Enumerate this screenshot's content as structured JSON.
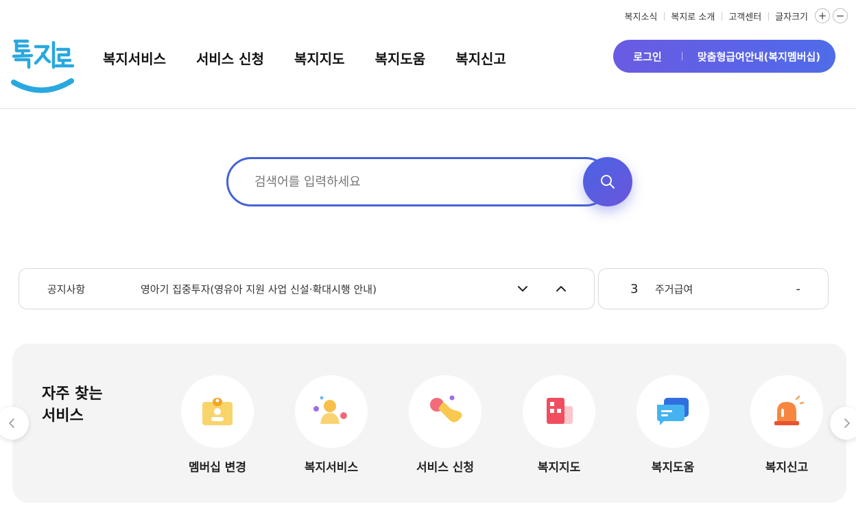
{
  "util": {
    "links": [
      "복지소식",
      "복지로 소개",
      "고객센터"
    ],
    "font_size_label": "글자크기",
    "plus": "+",
    "minus": "−"
  },
  "logo": {
    "text": "복지로",
    "brand_color": "#29a8e0"
  },
  "gnb": [
    "복지서비스",
    "서비스 신청",
    "복지지도",
    "복지도움",
    "복지신고"
  ],
  "member": {
    "login": "로그인",
    "guide": "맞춤형급여안내(복지멤버십)"
  },
  "search": {
    "placeholder": "검색어를 입력하세요",
    "icon": "search-icon"
  },
  "notice": {
    "label": "공지사항",
    "text": "영아기 집중투자(영유아 지원 사업 신설·확대시행 안내)",
    "down_icon": "chevron-down-icon",
    "up_icon": "chevron-up-icon"
  },
  "rank": {
    "number": "3",
    "text": "주거급여",
    "change": "-"
  },
  "frequent": {
    "title": "자주 찾는\n서비스",
    "items": [
      {
        "label": "멤버십 변경",
        "icon": "id-card-icon"
      },
      {
        "label": "복지서비스",
        "icon": "person-icon"
      },
      {
        "label": "서비스 신청",
        "icon": "hand-click-icon"
      },
      {
        "label": "복지지도",
        "icon": "map-icon"
      },
      {
        "label": "복지도움",
        "icon": "chat-icon"
      },
      {
        "label": "복지신고",
        "icon": "siren-icon"
      }
    ]
  },
  "colors": {
    "accent": "#4361d6",
    "pill_start": "#6a5be3",
    "pill_end": "#4f6ce8",
    "panel_bg": "#f4f4f4"
  }
}
